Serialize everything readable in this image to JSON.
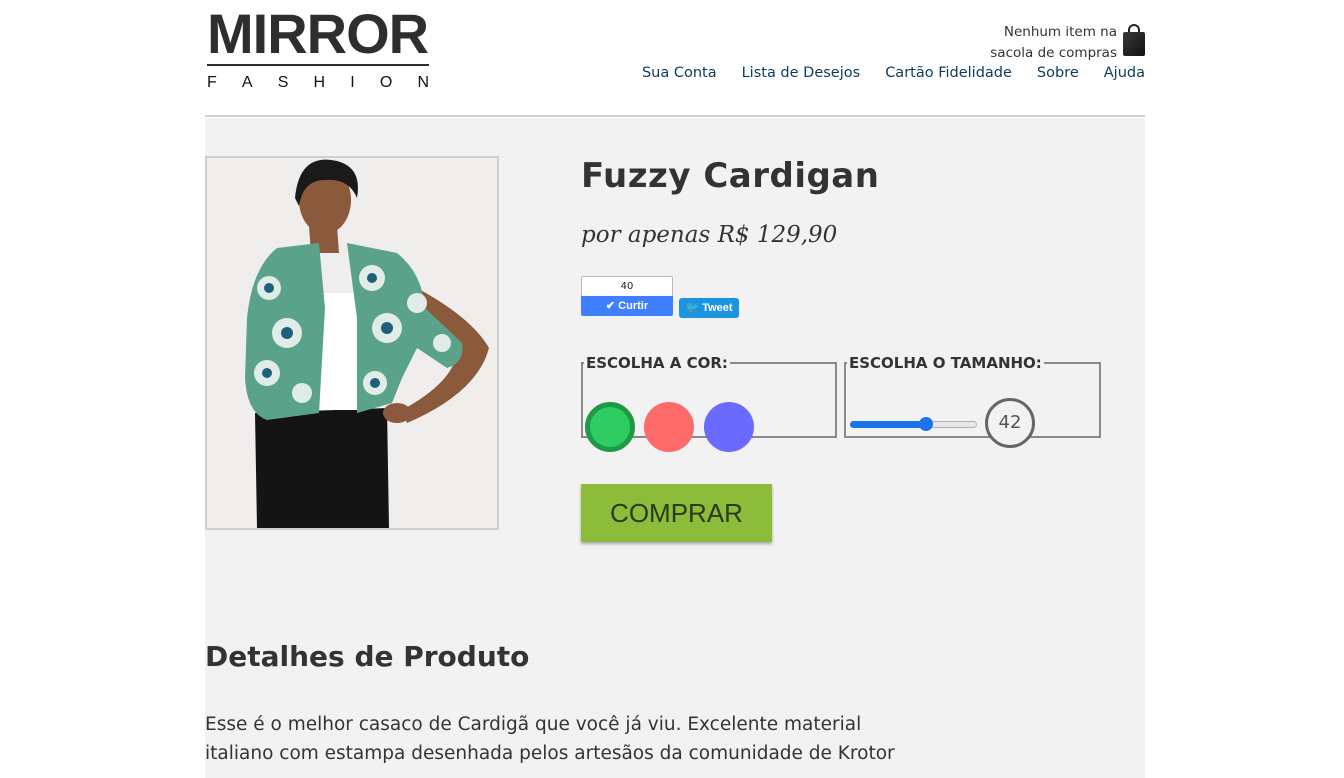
{
  "brand": {
    "name_top": "MIRROR",
    "name_bottom": [
      "F",
      "A",
      "S",
      "H",
      "I",
      "O",
      "N"
    ]
  },
  "cart": {
    "line1": "Nenhum item na",
    "line2": "sacola de compras",
    "icon": "shopping-bag-icon"
  },
  "nav": {
    "items": [
      "Sua Conta",
      "Lista de Desejos",
      "Cartão Fidelidade",
      "Sobre",
      "Ajuda"
    ]
  },
  "product": {
    "name": "Fuzzy Cardigan",
    "price": "por apenas R$ 129,90"
  },
  "social": {
    "like_count": "40",
    "like_label": "Curtir",
    "tweet_label": "Tweet"
  },
  "color_picker": {
    "legend": "ESCOLHA A COR:",
    "options": [
      {
        "name": "verde",
        "color": "#2ecc63",
        "selected": true
      },
      {
        "name": "rosa",
        "color": "#ff6a6a",
        "selected": false
      },
      {
        "name": "azul",
        "color": "#6a6aff",
        "selected": false
      }
    ]
  },
  "size_picker": {
    "legend": "ESCOLHA O TAMANHO:",
    "value": "42",
    "slider_fraction": 0.6
  },
  "buy_button": {
    "label": "COMPRAR",
    "color": "#8cbc3a"
  },
  "details": {
    "title": "Detalhes de Produto",
    "text": "Esse é o melhor casaco de Cardigã que você já viu. Excelente material italiano com estampa desenhada pelos artesãos da comunidade de Krotor"
  }
}
